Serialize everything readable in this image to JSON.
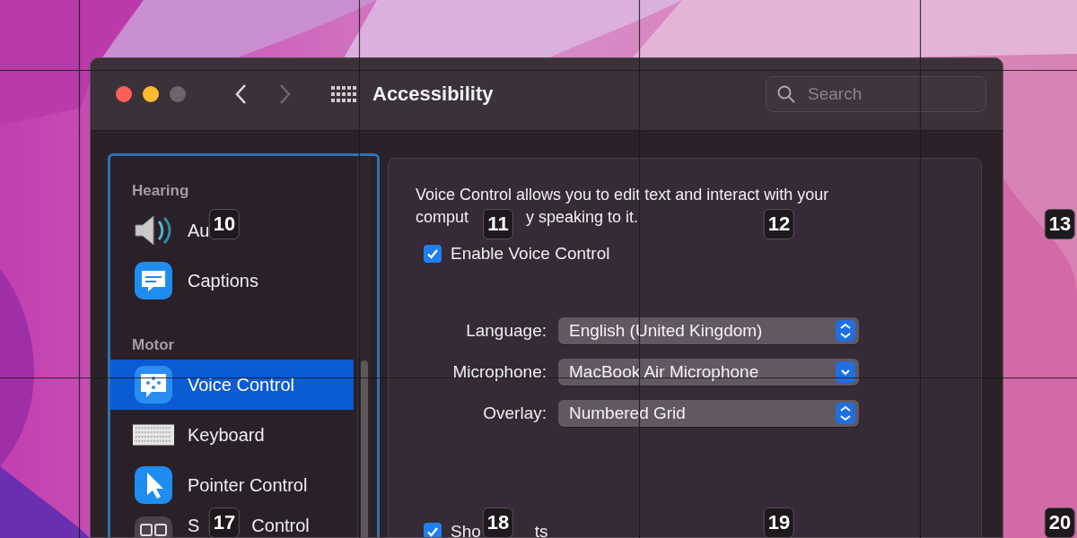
{
  "window": {
    "title": "Accessibility"
  },
  "toolbar": {
    "search": {
      "placeholder": "Search"
    }
  },
  "sidebar": {
    "sections": [
      {
        "heading": "Hearing",
        "items": [
          {
            "label_parts": [
              "Au"
            ],
            "kind": "speaker",
            "selected": false
          },
          {
            "label_parts": [
              "Captions"
            ],
            "kind": "captions",
            "selected": false
          }
        ]
      },
      {
        "heading": "Motor",
        "items": [
          {
            "label_parts": [
              "Voice Control"
            ],
            "kind": "voice",
            "selected": true
          },
          {
            "label_parts": [
              "Keyboard"
            ],
            "kind": "keyboard",
            "selected": false
          },
          {
            "label_parts": [
              "Pointer Control"
            ],
            "kind": "pointer",
            "selected": false
          },
          {
            "label_parts": [
              "S",
              "Control"
            ],
            "kind": "switch",
            "selected": false
          }
        ]
      }
    ]
  },
  "content": {
    "description_lines": [
      [
        "Voice Control allows you to edit text and interact with your"
      ],
      [
        "comput",
        "y speaking to it."
      ]
    ],
    "enable": {
      "label_parts": [
        "Enable Voice Control"
      ],
      "checked": true
    },
    "settings": [
      {
        "label": "Language:",
        "value": "English (United Kingdom)",
        "kind": "updown"
      },
      {
        "label": "Microphone:",
        "value": "MacBook Air Microphone",
        "kind": "down"
      },
      {
        "label": "Overlay:",
        "value": "Numbered Grid",
        "kind": "updown"
      }
    ],
    "hints": {
      "label_parts": [
        "Sho",
        "ts"
      ],
      "checked": true
    }
  },
  "grid_overlay": {
    "rows": [
      [
        "10",
        "11",
        "12",
        "13"
      ],
      [
        "17",
        "18",
        "19",
        "20"
      ]
    ]
  }
}
